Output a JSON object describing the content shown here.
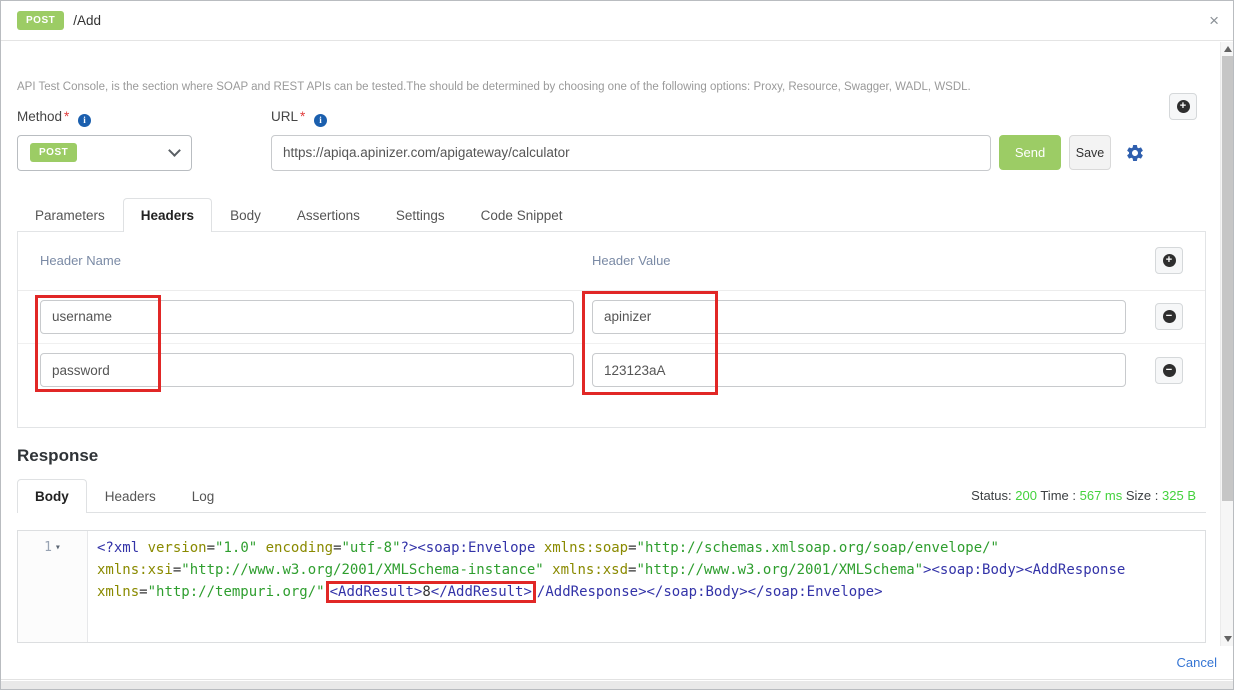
{
  "window": {
    "badge": "POST",
    "title": "/Add"
  },
  "icons": {
    "close": "×",
    "plus": "+",
    "minus": "−",
    "fold": "▾",
    "info": "i"
  },
  "intro": {
    "description": "API Test Console, is the section where SOAP and REST APIs can be tested.The should be determined by choosing one of the following options: Proxy, Resource, Swagger, WADL, WSDL."
  },
  "form": {
    "method_label": "Method",
    "url_label": "URL",
    "required_mark": "*",
    "method_value": "POST",
    "url_value": "https://apiqa.apinizer.com/apigateway/calculator",
    "send_label": "Send",
    "save_label": "Save"
  },
  "request_tabs": [
    {
      "label": "Parameters",
      "active": false
    },
    {
      "label": "Headers",
      "active": true
    },
    {
      "label": "Body",
      "active": false
    },
    {
      "label": "Assertions",
      "active": false
    },
    {
      "label": "Settings",
      "active": false
    },
    {
      "label": "Code Snippet",
      "active": false
    }
  ],
  "headers_panel": {
    "name_column": "Header Name",
    "value_column": "Header Value",
    "rows": [
      {
        "name": "username",
        "value": "apinizer"
      },
      {
        "name": "password",
        "value": "123123aA"
      }
    ]
  },
  "response": {
    "title": "Response",
    "tabs": [
      {
        "label": "Body",
        "active": true
      },
      {
        "label": "Headers",
        "active": false
      },
      {
        "label": "Log",
        "active": false
      }
    ],
    "status": {
      "status_label": "Status:",
      "status_value": "200",
      "time_label": "Time :",
      "time_value": "567 ms",
      "size_label": "Size :",
      "size_value": "325 B"
    },
    "editor": {
      "line_number": "1",
      "lines": [
        {
          "tokens": [
            {
              "c": "tag",
              "t": "<?xml "
            },
            {
              "c": "attr",
              "t": "version"
            },
            {
              "c": "text",
              "t": "="
            },
            {
              "c": "str",
              "t": "\"1.0\""
            },
            {
              "c": "text",
              "t": " "
            },
            {
              "c": "attr",
              "t": "encoding"
            },
            {
              "c": "text",
              "t": "="
            },
            {
              "c": "str",
              "t": "\"utf-8\""
            },
            {
              "c": "tag",
              "t": "?><soap:Envelope "
            },
            {
              "c": "attr",
              "t": "xmlns:soap"
            },
            {
              "c": "text",
              "t": "="
            },
            {
              "c": "str",
              "t": "\"http://schemas.xmlsoap.org/soap/envelope/\""
            }
          ]
        },
        {
          "tokens": [
            {
              "c": "attr",
              "t": "xmlns:xsi"
            },
            {
              "c": "text",
              "t": "="
            },
            {
              "c": "str",
              "t": "\"http://www.w3.org/2001/XMLSchema-instance\""
            },
            {
              "c": "text",
              "t": " "
            },
            {
              "c": "attr",
              "t": "xmlns:xsd"
            },
            {
              "c": "text",
              "t": "="
            },
            {
              "c": "str",
              "t": "\"http://www.w3.org/2001/XMLSchema\""
            },
            {
              "c": "tag",
              "t": "><soap:Body><AddResponse"
            }
          ]
        },
        {
          "tokens": [
            {
              "c": "attr",
              "t": "xmlns"
            },
            {
              "c": "text",
              "t": "="
            },
            {
              "c": "str",
              "t": "\"http://tempuri.org/\""
            },
            {
              "c": "tag",
              "t": "<AddResult>",
              "box": true
            },
            {
              "c": "text",
              "t": "8",
              "box": true
            },
            {
              "c": "tag",
              "t": "</AddResult>",
              "box": true
            },
            {
              "c": "tag",
              "t": "/AddResponse></soap:Body></soap:Envelope>"
            }
          ]
        }
      ]
    }
  },
  "footer": {
    "cancel_label": "Cancel"
  },
  "colors": {
    "accent_green": "#9ccc65",
    "status_green": "#43d23c",
    "annotation_red": "#e12726",
    "code_tag": "#3333a8",
    "code_attr": "#8a8a00",
    "code_str": "#2e9e2e",
    "link_blue": "#3575d4"
  }
}
